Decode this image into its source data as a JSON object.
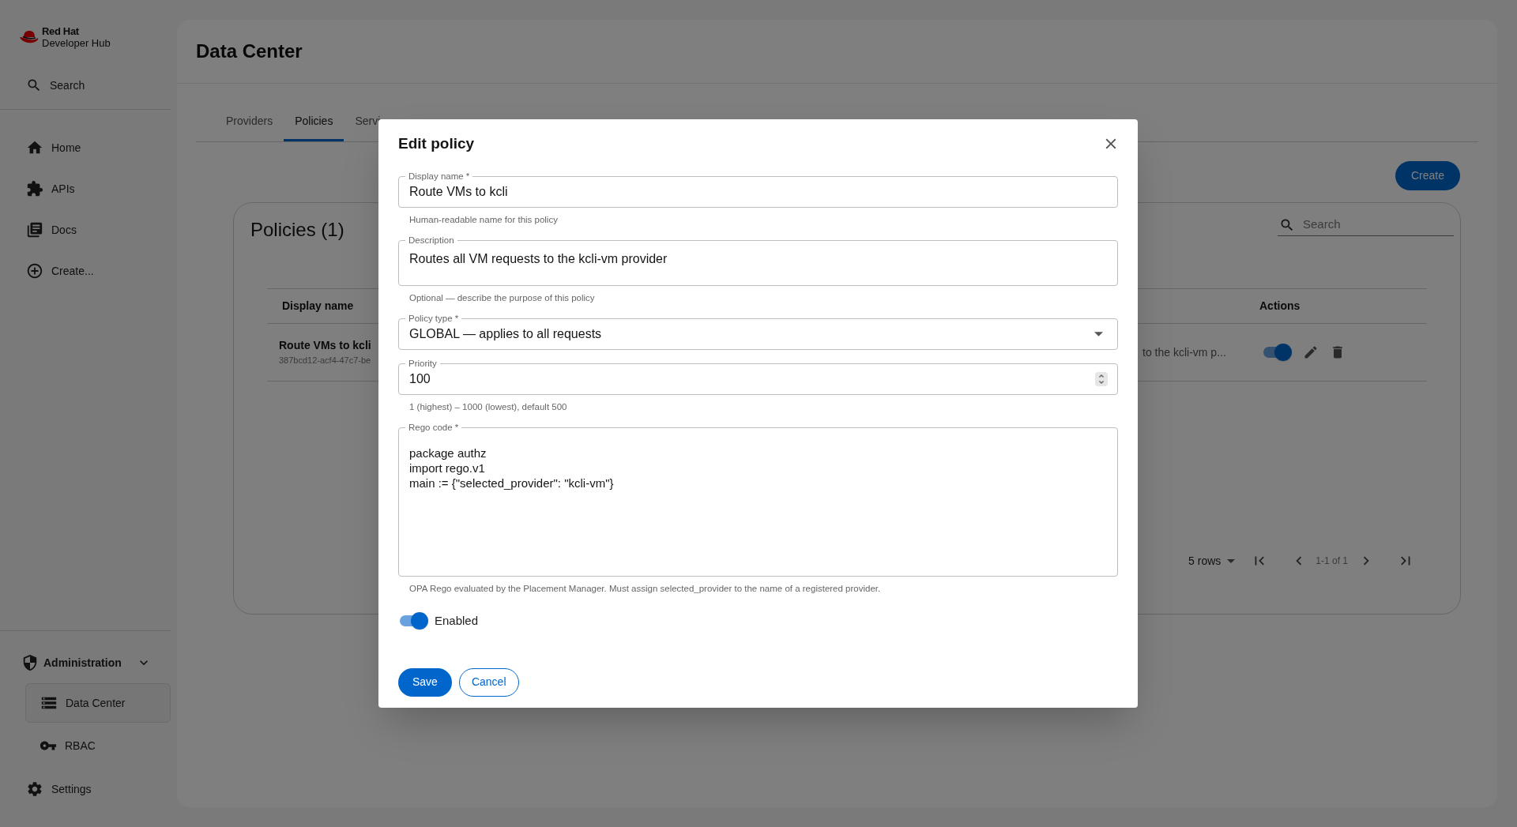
{
  "sidebar": {
    "logo": {
      "line1": "Red Hat",
      "line2": "Developer Hub"
    },
    "search": "Search",
    "items": [
      {
        "kind": "home",
        "label": "Home"
      },
      {
        "kind": "apis",
        "label": "APIs"
      },
      {
        "kind": "docs",
        "label": "Docs"
      },
      {
        "kind": "create",
        "label": "Create..."
      }
    ],
    "admin": {
      "label": "Administration",
      "expanded": true,
      "children": [
        {
          "kind": "datacenter",
          "label": "Data Center",
          "selected": true
        },
        {
          "kind": "rbac",
          "label": "RBAC",
          "selected": false
        }
      ]
    },
    "settings": "Settings"
  },
  "page": {
    "title": "Data Center",
    "tabs": [
      {
        "label": "Providers",
        "selected": false
      },
      {
        "label": "Policies",
        "selected": true
      },
      {
        "label": "Servi",
        "selected": false
      }
    ],
    "create_button": "Create"
  },
  "policies_card": {
    "title": "Policies (1)",
    "search_placeholder": "Search",
    "columns": [
      "Display name",
      "Actions"
    ],
    "rows": [
      {
        "name": "Route VMs to kcli",
        "id": "387bcd12-acf4-47c7-be",
        "description": "to the kcli-vm p...",
        "enabled": true
      }
    ],
    "pagination": {
      "rows_per_page": "5 rows",
      "range": "1-1 of 1"
    }
  },
  "dialog": {
    "title": "Edit policy",
    "fields": [
      {
        "kind": "text",
        "label": "Display name *",
        "value": "Route VMs to kcli",
        "helper": "Human-readable name for this policy"
      },
      {
        "kind": "textarea",
        "label": "Description",
        "value": "Routes all VM requests to the kcli-vm provider",
        "helper": "Optional — describe the purpose of this policy"
      },
      {
        "kind": "select",
        "label": "Policy type *",
        "value": "GLOBAL — applies to all requests"
      },
      {
        "kind": "number",
        "label": "Priority",
        "value": "100",
        "helper": "1 (highest) – 1000 (lowest), default 500"
      },
      {
        "kind": "code",
        "label": "Rego code *",
        "value": "package authz\nimport rego.v1\nmain := {\"selected_provider\": \"kcli-vm\"}",
        "helper": "OPA Rego evaluated by the Placement Manager. Must assign selected_provider to the name of a registered provider."
      }
    ],
    "enabled": {
      "label": "Enabled",
      "on": true
    },
    "buttons": [
      {
        "kind": "primary",
        "label": "Save"
      },
      {
        "kind": "outlined",
        "label": "Cancel"
      }
    ]
  }
}
